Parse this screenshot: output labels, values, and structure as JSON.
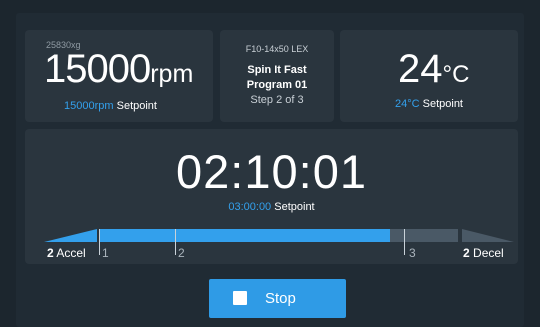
{
  "speed": {
    "rcf": "25830xg",
    "value": "15000",
    "unit": "rpm",
    "setpoint_value": "15000rpm",
    "setpoint_label": "Setpoint"
  },
  "program": {
    "rotor": "F10-14x50 LEX",
    "name": "Spin It Fast",
    "number": "Program 01",
    "step": "Step 2 of 3"
  },
  "temperature": {
    "value": "24",
    "unit": "°C",
    "setpoint_value": "24°C",
    "setpoint_label": "Setpoint"
  },
  "timer": {
    "elapsed": "02:10:01",
    "setpoint_value": "03:00:00",
    "setpoint_label": "Setpoint"
  },
  "progress": {
    "fraction": 0.81,
    "ticks": [
      "1",
      "2",
      "3"
    ],
    "accel_value": "2",
    "accel_label": "Accel",
    "decel_value": "2",
    "decel_label": "Decel"
  },
  "stop_button": {
    "label": "Stop"
  },
  "colors": {
    "accent": "#33a0ec",
    "background": "#1c262e",
    "card": "#2a353e",
    "track": "#4a5966"
  },
  "icons": {
    "stop": "stop-square-icon"
  }
}
